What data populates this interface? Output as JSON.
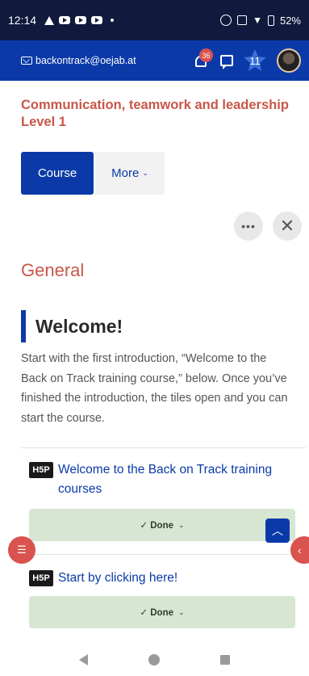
{
  "status_bar": {
    "time": "12:14",
    "battery": "52%"
  },
  "header": {
    "email": "backontrack@oejab.at",
    "notification_count": "36",
    "level": "11"
  },
  "course": {
    "title": "Communication, teamwork and leadership Level 1"
  },
  "tabs": {
    "course_label": "Course",
    "more_label": "More",
    "more_chevron": "⌄"
  },
  "actions": {
    "more_label": "•••",
    "close_label": "✕"
  },
  "section": {
    "title": "General",
    "welcome_heading": "Welcome!",
    "intro_text": "Start with the first introduction, “Welcome to the Back on Track training course,” below. Once you’ve finished the introduction, the tiles open and you can start the course."
  },
  "activities": [
    {
      "icon_label": "H5P",
      "title": "Welcome to the Back on Track training courses",
      "status": "✓ Done"
    },
    {
      "icon_label": "H5P",
      "title": "Start by clicking here!",
      "status": "✓ Done"
    }
  ],
  "colors": {
    "brand_blue": "#0b3aa8",
    "accent_red": "#c8574a",
    "done_green": "#d7e6d2"
  }
}
